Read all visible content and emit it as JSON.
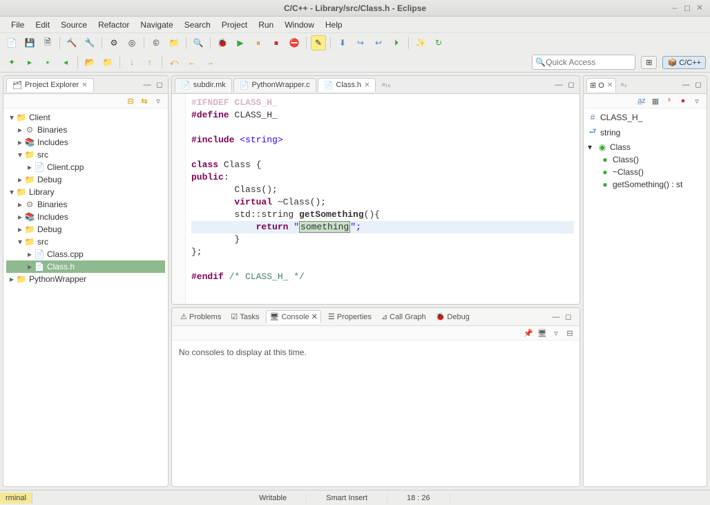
{
  "window": {
    "title": "C/C++ - Library/src/Class.h - Eclipse"
  },
  "menu": [
    "File",
    "Edit",
    "Source",
    "Refactor",
    "Navigate",
    "Search",
    "Project",
    "Run",
    "Window",
    "Help"
  ],
  "quick_access": {
    "placeholder": "Quick Access"
  },
  "perspective": {
    "cpp": "C/C++"
  },
  "project_explorer": {
    "title": "Project Explorer",
    "tree": {
      "client": "Client",
      "binaries": "Binaries",
      "includes": "Includes",
      "src": "src",
      "clientcpp": "Client.cpp",
      "debug": "Debug",
      "library": "Library",
      "classcpp": "Class.cpp",
      "classh": "Class.h",
      "pythonwrapper": "PythonWrapper"
    }
  },
  "editor_tabs": {
    "subdir": "subdir.mk",
    "pywrap": "PythonWrapper.c",
    "classh": "Class.h"
  },
  "code": {
    "l1": "#ifndef CLASS_H_",
    "l2a": "#define",
    "l2b": " CLASS_H_",
    "l3a": "#include",
    "l3b": " <string>",
    "l4a": "class",
    "l4b": " Class {",
    "l5a": "public",
    "l5b": ":",
    "l6": "        Class();",
    "l7a": "        virtual",
    "l7b": " ~Class();",
    "l8a": "        std::string ",
    "l8b": "getSomething",
    "l8c": "(){",
    "l9a": "            return",
    "l9b": " \"",
    "l9c": "something",
    "l9d": "\";",
    "l10": "        }",
    "l11": "};",
    "l12a": "#endif",
    "l12b": " /* CLASS_H_ */"
  },
  "bottom_tabs": {
    "problems": "Problems",
    "tasks": "Tasks",
    "console": "Console",
    "properties": "Properties",
    "callgraph": "Call Graph",
    "debug": "Debug"
  },
  "console_msg": "No consoles to display at this time.",
  "outline": {
    "classh": "CLASS_H_",
    "string": "string",
    "class": "Class",
    "ctor": "Class()",
    "dtor": "~Class()",
    "get": "getSomething() : st"
  },
  "status": {
    "terminal": "rminal",
    "writable": "Writable",
    "insert": "Smart Insert",
    "pos": "18 : 26"
  }
}
